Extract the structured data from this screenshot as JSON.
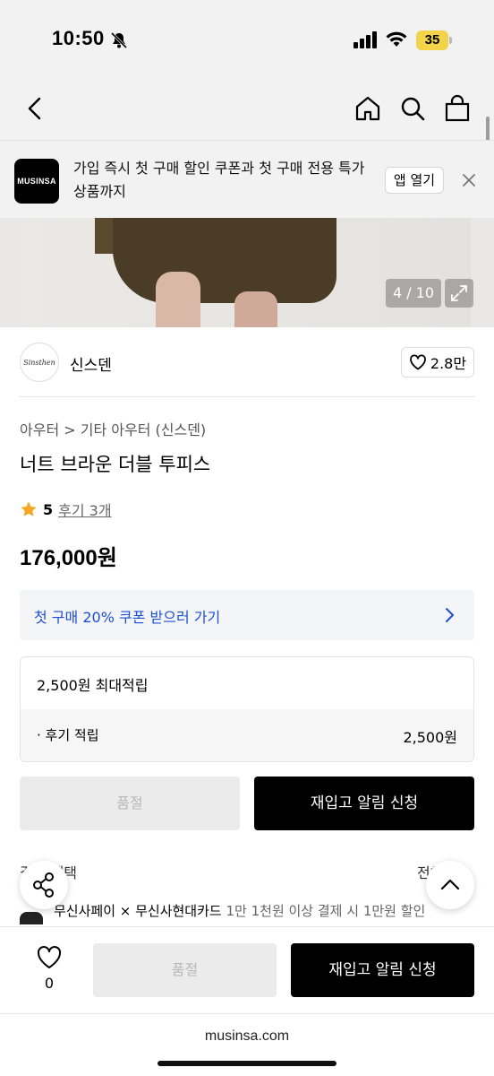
{
  "status_bar": {
    "time": "10:50",
    "battery": "35"
  },
  "banner": {
    "logo": "MUSINSA",
    "text": "가입 즉시 첫 구매 할인 쿠폰과 첫 구매 전용 특가 상품까지",
    "open_app": "앱 열기"
  },
  "hero": {
    "page_indicator": "4 / 10"
  },
  "brand": {
    "name": "신스덴",
    "avatar_text": "Sinsthen",
    "likes": "2.8만"
  },
  "product": {
    "breadcrumb": "아우터 > 기타 아우터 (신스덴)",
    "title": "너트 브라운 더블 투피스",
    "rating": "5",
    "reviews": "후기 3개",
    "price": "176,000원"
  },
  "coupon": {
    "text": "첫 구매 20% 쿠폰 받으러 가기"
  },
  "points": {
    "header": "2,500원 최대적립",
    "sub_label": "· 후기 적립",
    "sub_value": "2,500원"
  },
  "actions": {
    "soldout": "품절",
    "restock": "재입고 알림 신청"
  },
  "benefit": {
    "title": "결제 혜택",
    "more": "전체",
    "card_main": "무신사페이 × 무신사현대카드",
    "card_detail": " 1만 1천원 이상 결제 시 1만원 할인"
  },
  "bottom": {
    "wish_count": "0",
    "soldout": "품절",
    "restock": "재입고 알림 신청"
  },
  "browser": {
    "url": "musinsa.com"
  },
  "colors": {
    "accent_blue": "#1c4fd6",
    "star": "#f5a623",
    "battery": "#f3d34a"
  }
}
